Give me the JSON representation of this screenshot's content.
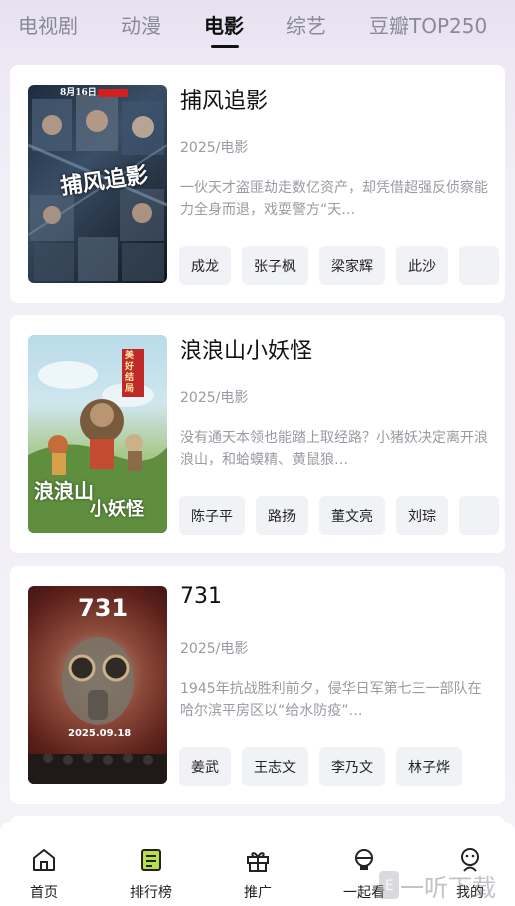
{
  "tabs": [
    "电视剧",
    "动漫",
    "电影",
    "综艺",
    "豆瓣TOP250"
  ],
  "active_tab": "电影",
  "cards": [
    {
      "title": "捕风追影",
      "meta": "2025/电影",
      "desc": "一伙天才盗匪劫走数亿资产，却凭借超强反侦察能力全身而退，戏耍警方“天…",
      "tags": [
        "成龙",
        "张子枫",
        "梁家辉",
        "此沙",
        ""
      ],
      "poster_text": [
        "8月16日",
        "捕风追影"
      ]
    },
    {
      "title": "浪浪山小妖怪",
      "meta": "2025/电影",
      "desc": "没有通天本领也能踏上取经路？小猪妖决定离开浪浪山，和蛤蟆精、黄鼠狼…",
      "tags": [
        "陈子平",
        "路扬",
        "董文亮",
        "刘琮",
        ""
      ],
      "poster_text": [
        "浪浪山",
        "小妖怪",
        "美好结局"
      ]
    },
    {
      "title": "731",
      "meta": "2025/电影",
      "desc": "1945年抗战胜利前夕，侵华日军第七三一部队在哈尔滨平房区以“给水防疫”…",
      "tags": [
        "姜武",
        "王志文",
        "李乃文",
        "林子烨"
      ],
      "poster_text": [
        "731",
        "2025.09.18"
      ]
    }
  ],
  "bottom_nav": [
    {
      "label": "首页",
      "icon": "home-icon"
    },
    {
      "label": "排行榜",
      "icon": "ranking-icon"
    },
    {
      "label": "推广",
      "icon": "gift-icon"
    },
    {
      "label": "一起看",
      "icon": "watch-together-icon"
    },
    {
      "label": "我的",
      "icon": "profile-icon"
    }
  ],
  "watermark": "一听下载",
  "colors": {
    "accent": "#111111",
    "muted": "#9a9aa2",
    "tag_bg": "#f1f2f5"
  }
}
